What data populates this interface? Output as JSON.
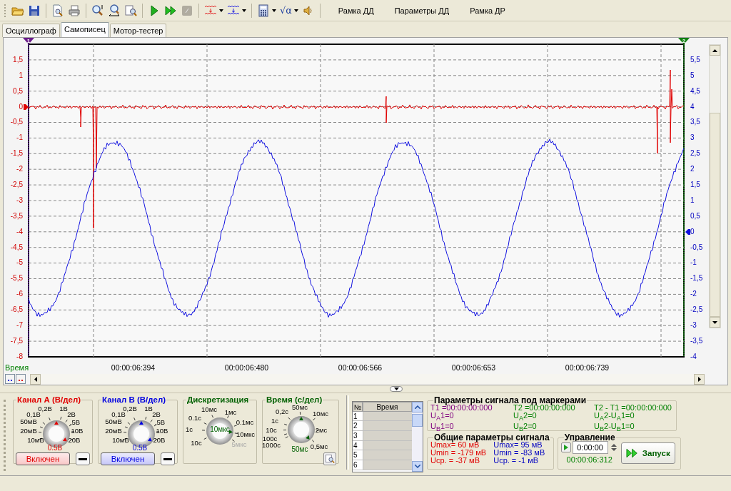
{
  "toolbar": {
    "formula_symbol": "√α",
    "menu_buttons": [
      "Рамка ДД",
      "Параметры ДД",
      "Рамка ДР"
    ]
  },
  "tabs": [
    {
      "label": "Осциллограф",
      "selected": false
    },
    {
      "label": "Самописец",
      "selected": true
    },
    {
      "label": "Мотор-тестер",
      "selected": false
    }
  ],
  "plot": {
    "markers": [
      "1",
      "2"
    ],
    "left_axis_ticks": [
      "1,5",
      "1",
      "0,5",
      "0",
      "-0,5",
      "-1",
      "-1,5",
      "-2",
      "-2,5",
      "-3",
      "-3,5",
      "-4",
      "-4,5",
      "-5",
      "-5,5",
      "-6",
      "-6,5",
      "-7",
      "-7,5",
      "-8"
    ],
    "right_axis_ticks": [
      "5,5",
      "5",
      "4,5",
      "4",
      "3,5",
      "3",
      "2,5",
      "2",
      "1,5",
      "1",
      "0,5",
      "0",
      "-0,5",
      "-1",
      "-1,5",
      "-2",
      "-2,5",
      "-3",
      "-3,5",
      "-4"
    ],
    "time_caption": "Время",
    "time_ticks": [
      "00:00:06:394",
      "00:00:06:480",
      "00:00:06:566",
      "00:00:06:653",
      "00:00:06:739"
    ]
  },
  "dials": [
    {
      "kind": "channel",
      "title": "Канал А (В/дел)",
      "color": "#e00000",
      "value": "0.5В",
      "button": "Включен",
      "labels": [
        {
          "text": "0,2В"
        },
        {
          "text": "1В"
        },
        {
          "text": "0,1В"
        },
        {
          "text": "2В"
        },
        {
          "text": "50мВ"
        },
        {
          "text": ".5В"
        },
        {
          "text": "20мВ"
        },
        {
          "text": "10В"
        },
        {
          "text": "10мВ"
        },
        {
          "text": "20В"
        }
      ]
    },
    {
      "kind": "channel",
      "title": "Канал В (В/дел)",
      "color": "#0000e0",
      "value": "0.5В",
      "button": "Включен",
      "labels": [
        {
          "text": "0,2В"
        },
        {
          "text": "1В"
        },
        {
          "text": "0,1В"
        },
        {
          "text": "2В"
        },
        {
          "text": "50мВ"
        },
        {
          "text": ".5В"
        },
        {
          "text": "20мВ"
        },
        {
          "text": "10В"
        },
        {
          "text": "10мВ"
        },
        {
          "text": "20В"
        }
      ]
    },
    {
      "kind": "sampling",
      "title": "Дискретизация",
      "color": "#006000",
      "value": "10мкс",
      "labels": [
        {
          "text": "10мс",
          "disabled": false
        },
        {
          "text": "1мс",
          "disabled": false
        },
        {
          "text": "0.1с",
          "disabled": false
        },
        {
          "text": "0.1мс",
          "disabled": false
        },
        {
          "text": "1с",
          "disabled": false
        },
        {
          "text": "10мкс",
          "disabled": false
        },
        {
          "text": "10с",
          "disabled": false
        },
        {
          "text": "5мкс",
          "disabled": true
        }
      ]
    },
    {
      "kind": "timebase",
      "title": "Время (с/дел)",
      "color": "#006000",
      "value": "50мс",
      "labels": [
        {
          "text": "0,2с"
        },
        {
          "text": "50мс"
        },
        {
          "text": "10мс"
        },
        {
          "text": "1с"
        },
        {
          "text": "10с"
        },
        {
          "text": "2мс"
        },
        {
          "text": "100с"
        },
        {
          "text": "1000с"
        },
        {
          "text": "0,5мс"
        }
      ]
    }
  ],
  "marker_table": {
    "columns": [
      "№",
      "Время"
    ],
    "rows": [
      "1",
      "2",
      "3",
      "4",
      "5",
      "6"
    ]
  },
  "marker_params": {
    "title": "Параметры сигнала под маркерами",
    "columns": [
      [
        "T1 =00:00:00:000",
        "U$_{A}$1=0",
        "U$_{B}$1=0"
      ],
      [
        "T2 =00:00:00:000",
        "U$_{A}$2=0",
        "U$_{B}$2=0"
      ],
      [
        "T2 - T1 =00:00:00:000",
        "U$_{A}$2-U$_{A}$1=0",
        "U$_{B}$2-U$_{B}$1=0"
      ]
    ]
  },
  "signal_params": {
    "title": "Общие параметры сигнала",
    "columns": [
      {
        "color": "#e00000",
        "lines": [
          "Umax= 60 мВ",
          "Umin = -179 мВ",
          "Uср. = -37 мВ"
        ]
      },
      {
        "color": "#0000c0",
        "lines": [
          "Umax= 95 мВ",
          "Umin = -83 мВ",
          "Uср. =  -1 мВ"
        ]
      }
    ]
  },
  "control": {
    "title": "Управление",
    "time_value": "0:00:00",
    "elapsed": "00:00:06:312",
    "start_button": "Запуск"
  }
}
